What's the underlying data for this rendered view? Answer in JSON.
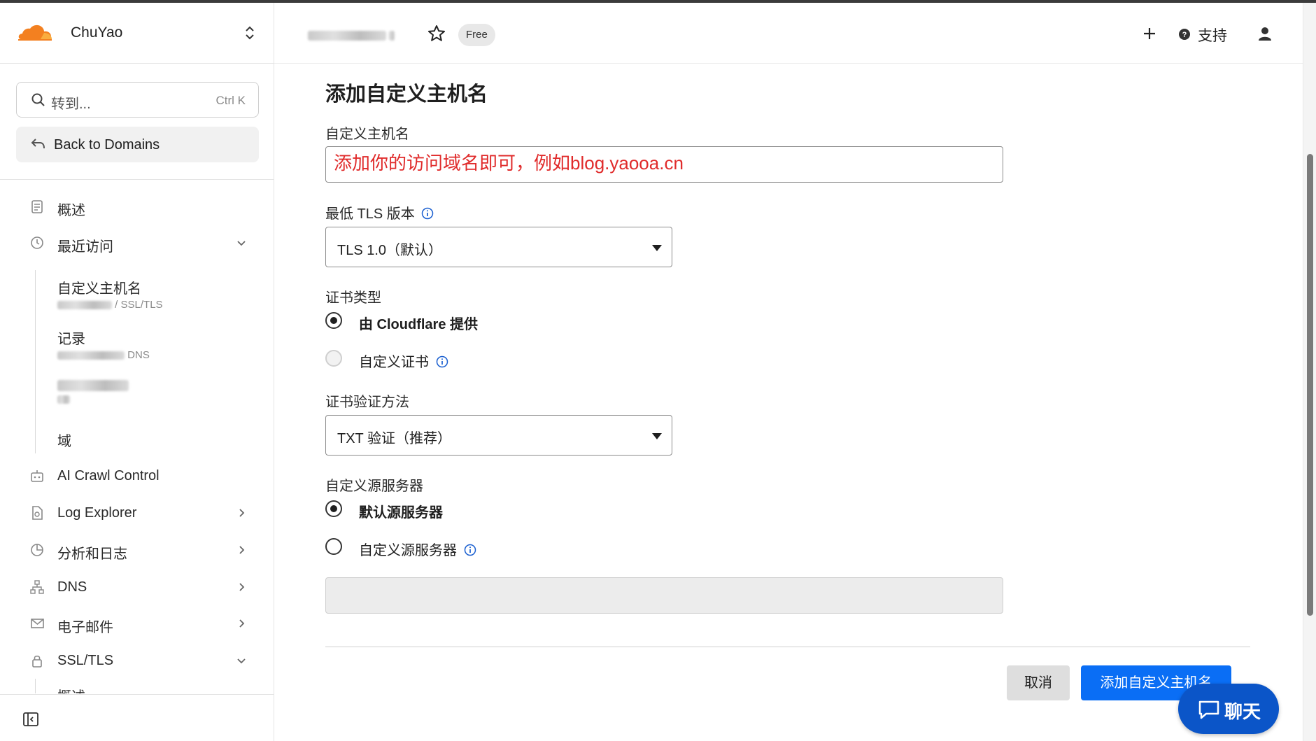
{
  "account": {
    "name": "ChuYao"
  },
  "search": {
    "placeholder": "转到...",
    "shortcut": "Ctrl K"
  },
  "sidebar": {
    "back_label": "Back to Domains",
    "overview": "概述",
    "recent": "最近访问",
    "recent_items": [
      {
        "title": "自定义主机名",
        "meta": "SSL/TLS"
      },
      {
        "title": "记录",
        "meta": "DNS"
      },
      {
        "title": "",
        "meta": ""
      },
      {
        "title": "域",
        "meta": ""
      }
    ],
    "items": [
      {
        "label": "AI Crawl Control"
      },
      {
        "label": "Log Explorer"
      },
      {
        "label": "分析和日志"
      },
      {
        "label": "DNS"
      },
      {
        "label": "电子邮件"
      },
      {
        "label": "SSL/TLS"
      }
    ],
    "ssl_sub": "概述"
  },
  "header": {
    "plan_badge": "Free",
    "support": "支持"
  },
  "form": {
    "title": "添加自定义主机名",
    "hostname_label": "自定义主机名",
    "hostname_value": "添加你的访问域名即可，例如blog.yaooa.cn",
    "tls_label": "最低 TLS 版本",
    "tls_value": "TLS 1.0（默认）",
    "cert_type_label": "证书类型",
    "cert_option_1": "由 Cloudflare 提供",
    "cert_option_2": "自定义证书",
    "verify_label": "证书验证方法",
    "verify_value": "TXT 验证（推荐）",
    "origin_label": "自定义源服务器",
    "origin_option_1": "默认源服务器",
    "origin_option_2": "自定义源服务器",
    "cancel": "取消",
    "submit": "添加自定义主机名"
  },
  "chat": {
    "label": "聊天"
  },
  "colors": {
    "brand_orange": "#f38020",
    "primary_blue": "#0a6ef5",
    "annotation_red": "#e02b2b",
    "chat_blue": "#0b55c8"
  },
  "icons": [
    "cloudflare-logo",
    "chevron-updown-icon",
    "search-icon",
    "back-arrow-icon",
    "star-icon",
    "plus-icon",
    "help-icon",
    "user-icon",
    "info-icon",
    "chat-icon",
    "collapse-sidebar-icon"
  ]
}
